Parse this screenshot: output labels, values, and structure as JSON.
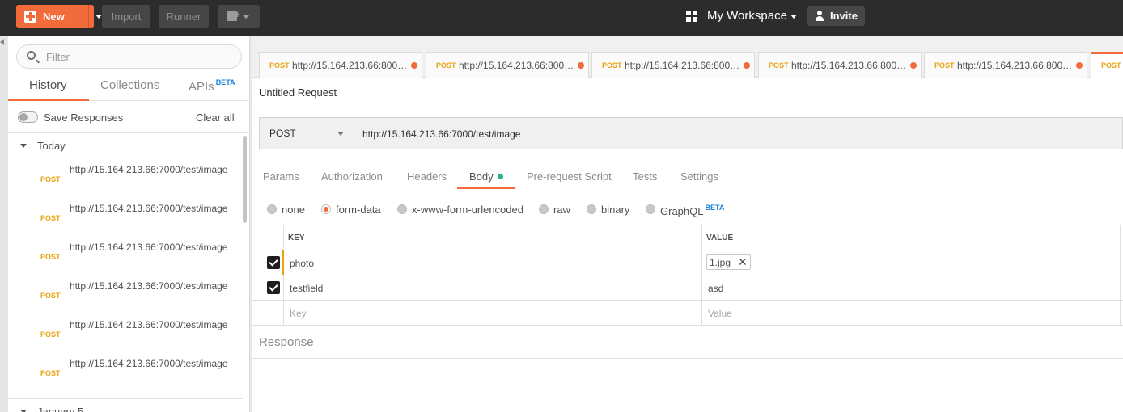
{
  "topbar": {
    "new_label": "New",
    "import_label": "Import",
    "runner_label": "Runner",
    "workspace_label": "My Workspace",
    "invite_label": "Invite"
  },
  "sidebar": {
    "filter_placeholder": "Filter",
    "tabs": [
      {
        "label": "History",
        "active": true
      },
      {
        "label": "Collections",
        "active": false
      },
      {
        "label": "APIs",
        "badge": "BETA",
        "active": false
      }
    ],
    "save_responses_label": "Save Responses",
    "clear_all_label": "Clear all",
    "groups": [
      {
        "label": "Today",
        "items": [
          {
            "method": "POST",
            "url": "http://15.164.213.66:7000/test/image"
          },
          {
            "method": "POST",
            "url": "http://15.164.213.66:7000/test/image"
          },
          {
            "method": "POST",
            "url": "http://15.164.213.66:7000/test/image"
          },
          {
            "method": "POST",
            "url": "http://15.164.213.66:7000/test/image"
          },
          {
            "method": "POST",
            "url": "http://15.164.213.66:7000/test/image"
          },
          {
            "method": "POST",
            "url": "http://15.164.213.66:7000/test/image"
          }
        ]
      },
      {
        "label": "January 5",
        "items": []
      }
    ]
  },
  "main": {
    "request_tabs": [
      {
        "method": "POST",
        "url": "http://15.164.213.66:8000/..."
      },
      {
        "method": "POST",
        "url": "http://15.164.213.66:8000/..."
      },
      {
        "method": "POST",
        "url": "http://15.164.213.66:8000/..."
      },
      {
        "method": "POST",
        "url": "http://15.164.213.66:8000/..."
      },
      {
        "method": "POST",
        "url": "http://15.164.213.66:8000/..."
      },
      {
        "method": "POST",
        "url": ""
      }
    ],
    "request_title": "Untitled Request",
    "method": "POST",
    "url": "http://15.164.213.66:7000/test/image",
    "sub_tabs": [
      {
        "label": "Params"
      },
      {
        "label": "Authorization"
      },
      {
        "label": "Headers"
      },
      {
        "label": "Body",
        "active": true
      },
      {
        "label": "Pre-request Script"
      },
      {
        "label": "Tests"
      },
      {
        "label": "Settings"
      }
    ],
    "body_types": [
      {
        "label": "none"
      },
      {
        "label": "form-data",
        "selected": true
      },
      {
        "label": "x-www-form-urlencoded"
      },
      {
        "label": "raw"
      },
      {
        "label": "binary"
      },
      {
        "label": "GraphQL",
        "badge": "BETA"
      }
    ],
    "table": {
      "key_header": "KEY",
      "value_header": "VALUE",
      "rows": [
        {
          "checked": true,
          "key": "photo",
          "value": "1.jpg",
          "is_file": true
        },
        {
          "checked": true,
          "key": "testfield",
          "value": "asd",
          "is_file": false
        }
      ],
      "key_placeholder": "Key",
      "value_placeholder": "Value"
    },
    "response_label": "Response"
  },
  "colors": {
    "accent": "#f26b3a",
    "post_method": "#e8a30c",
    "beta_badge": "#1a7fd6",
    "body_dot": "#26b47f",
    "topbar": "#2c2c2c"
  }
}
